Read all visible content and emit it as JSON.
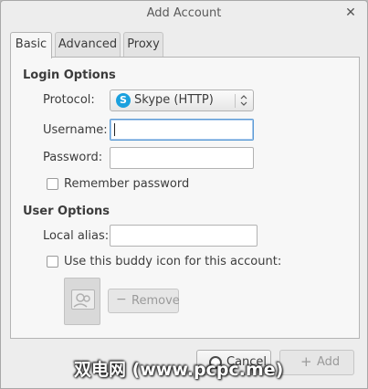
{
  "window": {
    "title": "Add Account"
  },
  "tabs": [
    {
      "label": "Basic",
      "active": true
    },
    {
      "label": "Advanced",
      "active": false
    },
    {
      "label": "Proxy",
      "active": false
    }
  ],
  "login": {
    "section_title": "Login Options",
    "protocol_label": "Protocol:",
    "protocol_value": "Skype (HTTP)",
    "protocol_icon": "skype-icon",
    "username_label": "Username:",
    "username_value": "",
    "password_label": "Password:",
    "password_value": "",
    "remember_label": "Remember password",
    "remember_checked": false
  },
  "user": {
    "section_title": "User Options",
    "alias_label": "Local alias:",
    "alias_value": "",
    "buddy_label": "Use this buddy icon for this account:",
    "buddy_checked": false,
    "remove_label": "Remove"
  },
  "buttons": {
    "cancel_label": "Cancel",
    "add_label": "Add"
  },
  "watermark": "双电网 (www.pcpc.me)",
  "colors": {
    "accent": "#5b9bd5",
    "skype": "#1aa0de"
  }
}
